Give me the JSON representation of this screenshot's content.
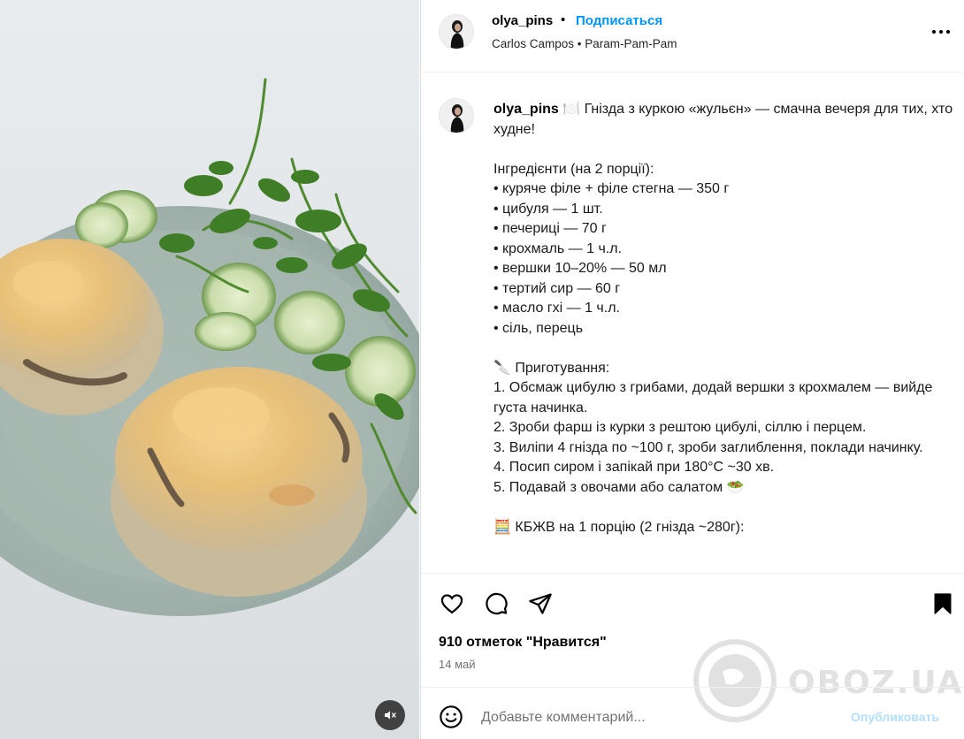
{
  "post": {
    "username": "olya_pins",
    "follow_label": "Подписаться",
    "separator": "•",
    "audio_artist": "Carlos Campos",
    "audio_track": "Param-Pam-Pam",
    "audio_line": "Carlos Campos • Param-Pam-Pam"
  },
  "caption": {
    "username": "olya_pins",
    "text": " 🍽️ Гнізда з куркою «жульєн» — смачна вечеря для тих, хто худне!\n\nІнгредієнти (на 2 порції):\n• куряче філе + філе стегна — 350 г\n• цибуля — 1 шт.\n• печериці — 70 г\n• крохмаль — 1 ч.л.\n• вершки 10–20% — 50 мл\n• тертий сир — 60 г\n• масло гхі — 1 ч.л.\n• сіль, перець\n\n🔪 Приготування:\n1. Обсмаж цибулю з грибами, додай вершки з крохмалем — вийде густа начинка.\n2. Зроби фарш із курки з рештою цибулі, сіллю і перцем.\n3. Виліпи 4 гнізда по ~100 г, зроби заглиблення, поклади начинку.\n4. Посип сиром і запікай при 180°C ~30 хв.\n5. Подавай з овочами або салатом 🥗\n\n🧮 КБЖВ на 1 порцію (2 гнізда ~280г):"
  },
  "stats": {
    "likes": "910 отметок \"Нравится\"",
    "date": "14 май"
  },
  "comment": {
    "placeholder": "Добавьте комментарий...",
    "publish_label": "Опубликовать"
  },
  "watermark": {
    "text": "OBOZ.UA"
  },
  "icons": {
    "more": "more-horizontal-icon",
    "like": "heart-icon",
    "comment": "comment-bubble-icon",
    "share": "paper-plane-icon",
    "save": "bookmark-filled-icon",
    "emoji": "smiley-icon",
    "mute": "speaker-muted-icon"
  },
  "colors": {
    "accent": "#0095f6",
    "publish_disabled": "#b2dffc",
    "muted_text": "#737373"
  }
}
